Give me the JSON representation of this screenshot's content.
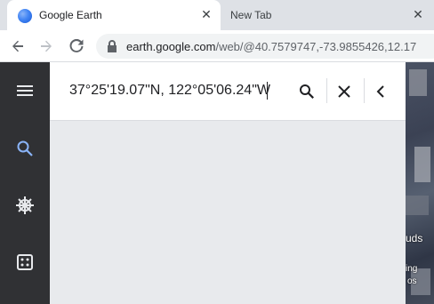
{
  "browser": {
    "tabs": [
      {
        "title": "Google Earth",
        "active": true
      },
      {
        "title": "New Tab",
        "active": false
      }
    ],
    "close_glyph": "✕",
    "url_main": "earth.google.com",
    "url_rest": "/web/@40.7579747,-73.9855426,12.17"
  },
  "search": {
    "query": "37°25'19.07\"N, 122°05'06.24\"W"
  },
  "map": {
    "label_1": "uds",
    "label_2": "ing",
    "label_3": "os"
  },
  "colors": {
    "rail_bg": "#303134",
    "accent": "#8ab4f8",
    "panel_bg": "#e8eaed"
  }
}
